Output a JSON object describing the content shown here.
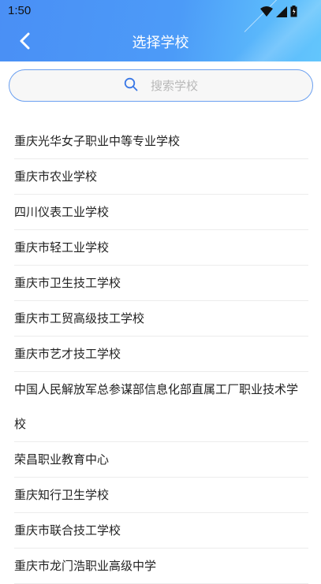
{
  "status_bar": {
    "time": "1:50"
  },
  "nav": {
    "title": "选择学校"
  },
  "search": {
    "placeholder": "搜索学校"
  },
  "schools": [
    "重庆光华女子职业中等专业学校",
    "重庆市农业学校",
    "四川仪表工业学校",
    "重庆市轻工业学校",
    "重庆市卫生技工学校",
    "重庆市工贸高级技工学校",
    "重庆市艺才技工学校",
    "中国人民解放军总参谋部信息化部直属工厂职业技术学校",
    "荣昌职业教育中心",
    "重庆知行卫生学校",
    "重庆市联合技工学校",
    "重庆市龙门浩职业高级中学"
  ],
  "icons": {
    "back": "back-arrow-icon",
    "search": "search-icon",
    "wifi": "wifi-icon",
    "signal": "signal-icon",
    "battery": "battery-icon"
  },
  "colors": {
    "header_start": "#4a8ff5",
    "header_end": "#63c6fc",
    "search_border": "#6a9ff0",
    "search_icon": "#3a78e6"
  }
}
